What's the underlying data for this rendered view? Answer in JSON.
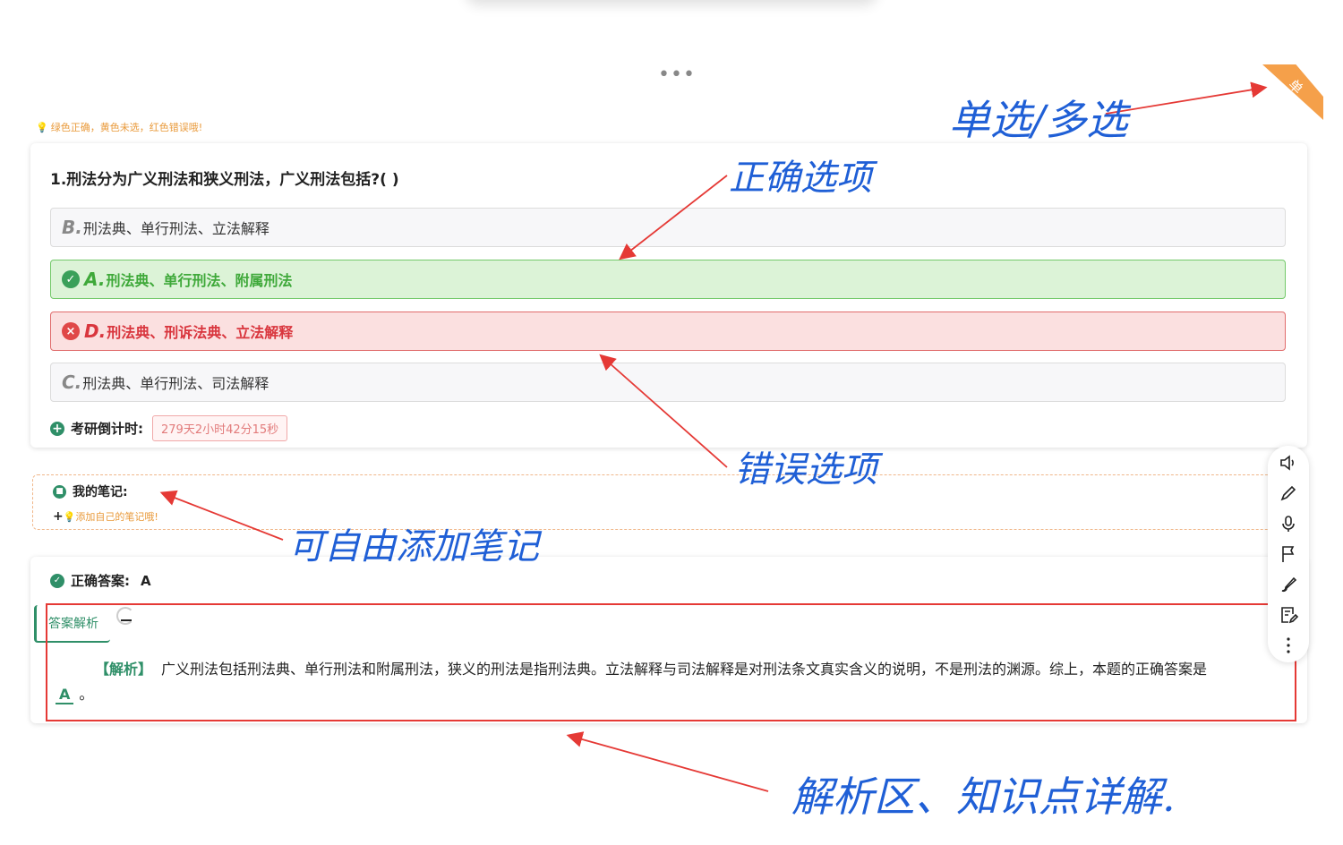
{
  "hint": "绿色正确，黄色未选，红色错误哦!",
  "corner_badge": "单",
  "question": {
    "title": "1.刑法分为广义刑法和狭义刑法，广义刑法包括?( )",
    "options": [
      {
        "letter": "B.",
        "text": "刑法典、单行刑法、立法解释",
        "state": "neutral"
      },
      {
        "letter": "A.",
        "text": "刑法典、单行刑法、附属刑法",
        "state": "correct"
      },
      {
        "letter": "D.",
        "text": "刑法典、刑诉法典、立法解释",
        "state": "wrong"
      },
      {
        "letter": "C.",
        "text": "刑法典、单行刑法、司法解释",
        "state": "neutral"
      }
    ],
    "countdown_label": "考研倒计时:",
    "countdown_value": "279天2小时42分15秒"
  },
  "notes": {
    "title": "我的笔记:",
    "add_prompt": "添加自己的笔记哦!"
  },
  "answer": {
    "label": "正确答案:",
    "value": "A",
    "tab_label": "答案解析",
    "analysis_tag": "【解析】",
    "analysis_body": "广义刑法包括刑法典、单行刑法和附属刑法，狭义的刑法是指刑法典。立法解释与司法解释是对刑法条文真实含义的说明，不是刑法的渊源。综上，本题的正确答案是",
    "analysis_answer": "A",
    "analysis_end": "。"
  },
  "toolbar": [
    "speaker-icon",
    "pencil-icon",
    "microphone-icon",
    "flag-icon",
    "brush-icon",
    "note-edit-icon",
    "more-vertical-icon"
  ],
  "annotations": {
    "single_multi": "单选/多选",
    "correct_option": "正确选项",
    "wrong_option": "错误选项",
    "add_notes": "可自由添加笔记",
    "analysis_area": "解析区、知识点详解."
  },
  "colors": {
    "correct": "#3fa93a",
    "wrong": "#d9363e",
    "accent": "#2f8f68",
    "annotation": "#1f5fd6",
    "arrow": "#e53935"
  }
}
